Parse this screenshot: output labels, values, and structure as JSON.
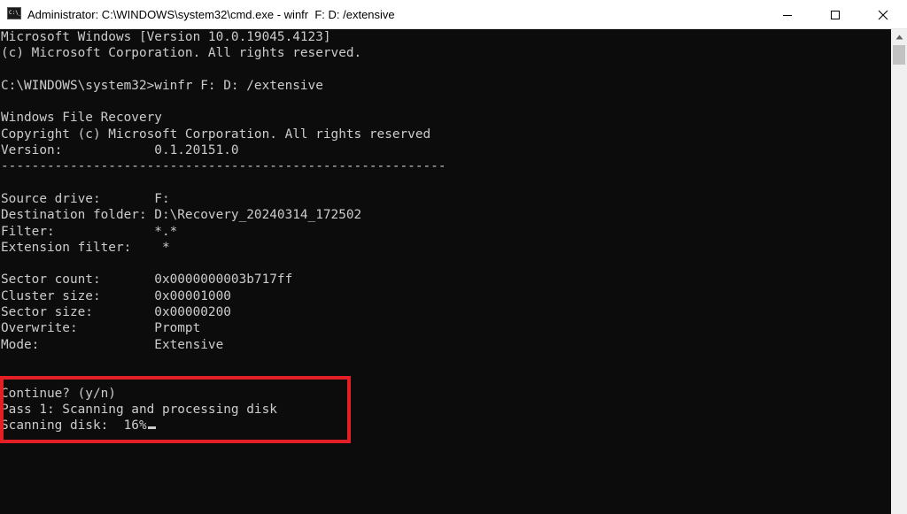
{
  "window": {
    "title": "Administrator: C:\\WINDOWS\\system32\\cmd.exe - winfr  F: D: /extensive",
    "icon": "cmd-icon",
    "icon_text": "C:\\_",
    "controls": {
      "minimize_icon": "minimize-icon",
      "maximize_icon": "maximize-icon",
      "close_icon": "close-icon"
    }
  },
  "console": {
    "lines": [
      "Microsoft Windows [Version 10.0.19045.4123]",
      "(c) Microsoft Corporation. All rights reserved.",
      "",
      "C:\\WINDOWS\\system32>winfr F: D: /extensive",
      "",
      "Windows File Recovery",
      "Copyright (c) Microsoft Corporation. All rights reserved",
      "Version:            0.1.20151.0",
      "----------------------------------------------------------",
      "",
      "Source drive:       F:",
      "Destination folder: D:\\Recovery_20240314_172502",
      "Filter:             *.*",
      "Extension filter:    *",
      "",
      "Sector count:       0x0000000003b717ff",
      "Cluster size:       0x00001000",
      "Sector size:        0x00000200",
      "Overwrite:          Prompt",
      "Mode:               Extensive",
      "",
      "",
      "Continue? (y/n)",
      "Pass 1: Scanning and processing disk",
      "Scanning disk:  16%"
    ],
    "highlight_color": "#e31e24"
  }
}
